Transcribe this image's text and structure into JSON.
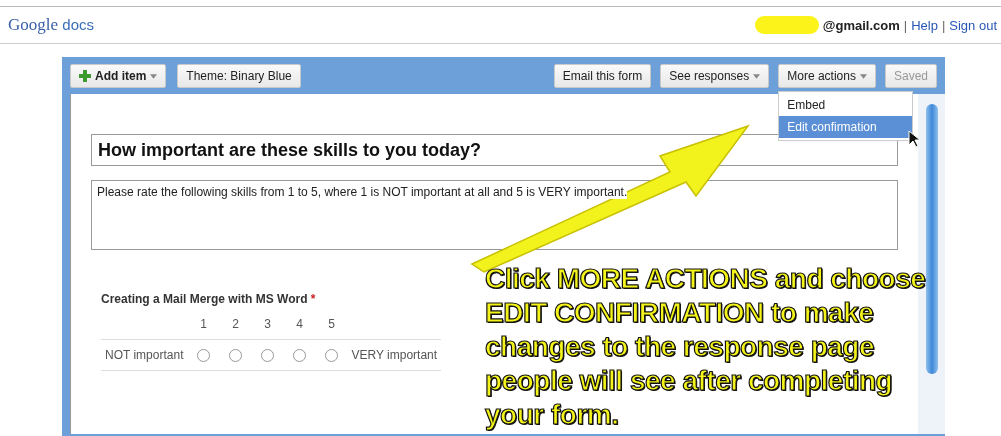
{
  "header": {
    "logo": {
      "brand": "Google",
      "product": "docs"
    },
    "account": {
      "email": "@gmail.com",
      "separator": "|",
      "links": [
        "Help",
        "Sign out"
      ]
    }
  },
  "toolbar": {
    "left": [
      {
        "label": "Add item",
        "kind": "add",
        "dropdown": true
      },
      {
        "label": "Theme:  Binary Blue",
        "kind": "plain",
        "dropdown": false
      }
    ],
    "right": [
      {
        "label": "Email this form",
        "dropdown": false,
        "disabled": false
      },
      {
        "label": "See responses",
        "dropdown": true,
        "disabled": false
      },
      {
        "label": "More actions",
        "dropdown": true,
        "disabled": false,
        "menu": true
      },
      {
        "label": "Saved",
        "dropdown": false,
        "disabled": true
      }
    ]
  },
  "menu": {
    "items": [
      {
        "label": "Embed",
        "selected": false
      },
      {
        "label": "Edit confirmation",
        "selected": true
      }
    ]
  },
  "form": {
    "title": "How important are these skills to you today?",
    "description": "Please rate the following skills from 1 to 5, where 1 is NOT important at all and 5 is VERY important.",
    "questions": [
      {
        "title": "Creating a Mail Merge with MS Word",
        "mark": "*",
        "scale": [
          "1",
          "2",
          "3",
          "4",
          "5"
        ],
        "low_label": "NOT important",
        "high_label": "VERY important",
        "options": [
          {
            "selected": false
          },
          {
            "selected": false
          },
          {
            "selected": false
          },
          {
            "selected": false
          },
          {
            "selected": false
          }
        ]
      }
    ]
  },
  "callout": {
    "lines": [
      "Click MORE ACTIONS and choose",
      "EDIT CONFIRMATION to make",
      "changes to the response page",
      "people will see after completing",
      "your form."
    ]
  }
}
